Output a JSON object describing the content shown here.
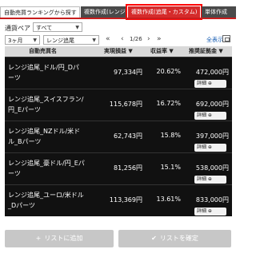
{
  "tabs": [
    {
      "label": "自動売買ランキングから探す"
    },
    {
      "label": "複数作成(レンジ)"
    },
    {
      "label": "複数作成(追尾・カスタム)"
    },
    {
      "label": "単体作成"
    }
  ],
  "filters": {
    "pair_label": "通貨ペア",
    "pair_value": "すべて",
    "period_value": "3ヶ月",
    "type_value": "レンジ追尾"
  },
  "pager": {
    "first": "«",
    "prev": "‹",
    "text": "1/26",
    "next": "›",
    "last": "»",
    "full_label": "全表示"
  },
  "table": {
    "headers": [
      "自動売買名",
      "実現損益 ▼",
      "収益率 ▼",
      "推奨証拠金 ▼"
    ],
    "detail_label": "詳細 ⊕",
    "rows": [
      {
        "name": "レンジ追尾_ドル/円_Dパーツ",
        "pnl": "97,334円",
        "rate": "20.62%",
        "margin": "472,000円"
      },
      {
        "name": "レンジ追尾_スイスフラン/円_Eパーツ",
        "pnl": "115,678円",
        "rate": "16.72%",
        "margin": "692,000円"
      },
      {
        "name": "レンジ追尾_NZドル/米ドル_Bパーツ",
        "pnl": "62,743円",
        "rate": "15.8%",
        "margin": "397,000円"
      },
      {
        "name": "レンジ追尾_豪ドル/円_Eパーツ",
        "pnl": "81,256円",
        "rate": "15.1%",
        "margin": "538,000円"
      },
      {
        "name": "レンジ追尾_ユーロ/米ドル_Dパーツ",
        "pnl": "113,369円",
        "rate": "13.61%",
        "margin": "833,000円"
      }
    ]
  },
  "buttons": {
    "add_label": "リストに追加",
    "confirm_label": "リストを確定"
  },
  "colors": {
    "active_tab": "#d52b2b",
    "tab_dark": "#4a4a4a",
    "table_bg": "#111111",
    "button_disabled": "#c7c7c7"
  }
}
